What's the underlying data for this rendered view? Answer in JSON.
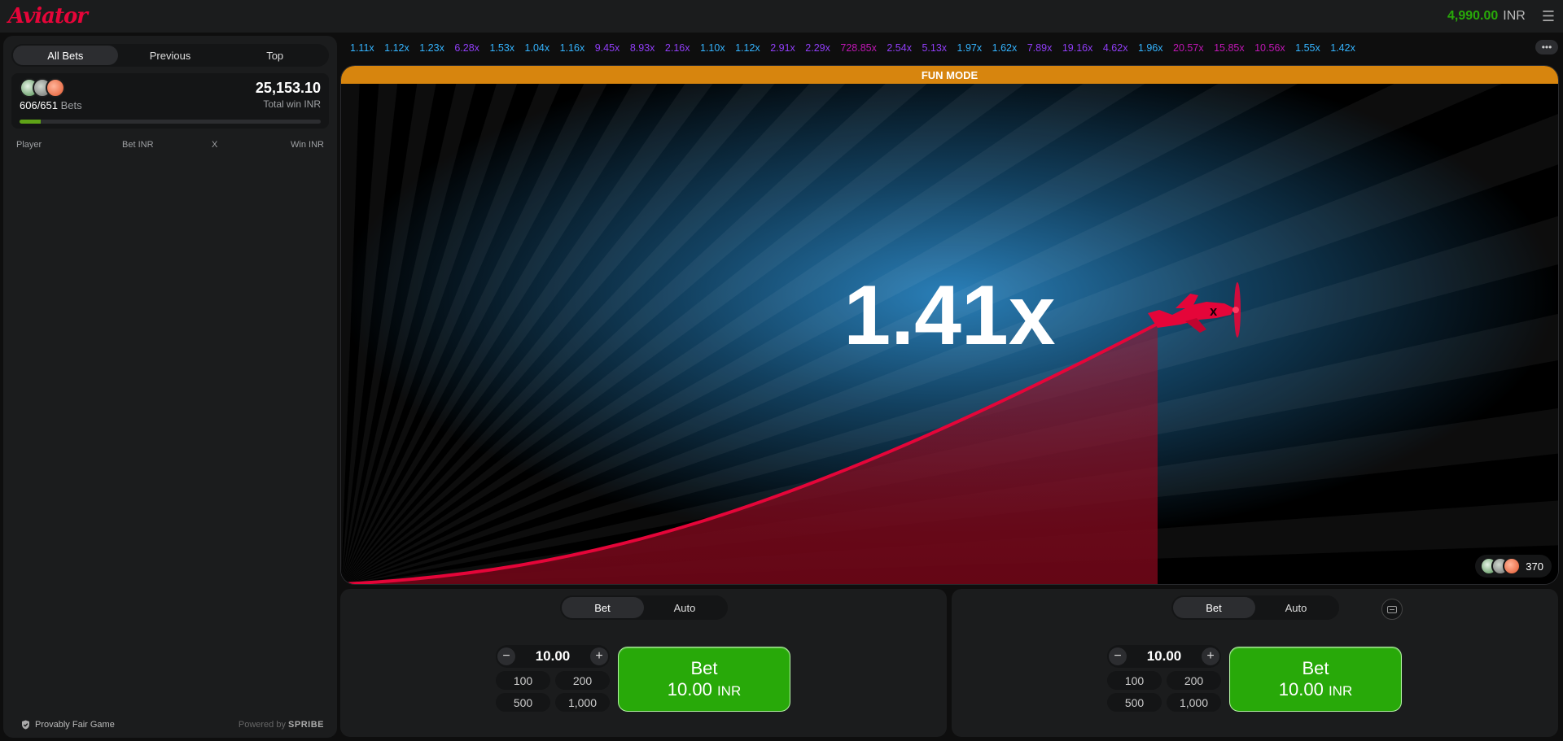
{
  "app": {
    "logo": "Aviator",
    "balance": "4,990.00",
    "currency": "INR"
  },
  "left": {
    "tabs": [
      "All Bets",
      "Previous",
      "Top"
    ],
    "active_tab": "All Bets",
    "bets_count": "606/651",
    "bets_label": "Bets",
    "total_win": "25,153.10",
    "total_win_label": "Total win INR",
    "bets_progress": 0.07,
    "columns": [
      "Player",
      "Bet INR",
      "X",
      "Win INR"
    ],
    "provably_fair": "Provably Fair Game",
    "powered_by": "Powered by",
    "provider": "SPRIBE"
  },
  "history": [
    {
      "v": "1.11x",
      "c": "blue"
    },
    {
      "v": "1.12x",
      "c": "blue"
    },
    {
      "v": "1.23x",
      "c": "blue"
    },
    {
      "v": "6.28x",
      "c": "purple"
    },
    {
      "v": "1.53x",
      "c": "blue"
    },
    {
      "v": "1.04x",
      "c": "blue"
    },
    {
      "v": "1.16x",
      "c": "blue"
    },
    {
      "v": "9.45x",
      "c": "purple"
    },
    {
      "v": "8.93x",
      "c": "purple"
    },
    {
      "v": "2.16x",
      "c": "purple"
    },
    {
      "v": "1.10x",
      "c": "blue"
    },
    {
      "v": "1.12x",
      "c": "blue"
    },
    {
      "v": "2.91x",
      "c": "purple"
    },
    {
      "v": "2.29x",
      "c": "purple"
    },
    {
      "v": "728.85x",
      "c": "pink"
    },
    {
      "v": "2.54x",
      "c": "purple"
    },
    {
      "v": "5.13x",
      "c": "purple"
    },
    {
      "v": "1.97x",
      "c": "blue"
    },
    {
      "v": "1.62x",
      "c": "blue"
    },
    {
      "v": "7.89x",
      "c": "purple"
    },
    {
      "v": "19.16x",
      "c": "purple"
    },
    {
      "v": "4.62x",
      "c": "purple"
    },
    {
      "v": "1.96x",
      "c": "blue"
    },
    {
      "v": "20.57x",
      "c": "pink"
    },
    {
      "v": "15.85x",
      "c": "pink"
    },
    {
      "v": "10.56x",
      "c": "pink"
    },
    {
      "v": "1.55x",
      "c": "blue"
    },
    {
      "v": "1.42x",
      "c": "blue"
    }
  ],
  "history_colors": {
    "blue": "#34b4ff",
    "purple": "#913ef8",
    "pink": "#c017b4"
  },
  "game": {
    "mode_banner": "FUN MODE",
    "multiplier": "1.41x",
    "players_online": "370"
  },
  "bet_panels": [
    {
      "tabs": [
        "Bet",
        "Auto"
      ],
      "active_tab": "Bet",
      "stake": "10.00",
      "quick": [
        "100",
        "200",
        "500",
        "1,000"
      ],
      "button_title": "Bet",
      "button_amount": "10.00",
      "button_currency": "INR"
    },
    {
      "tabs": [
        "Bet",
        "Auto"
      ],
      "active_tab": "Bet",
      "stake": "10.00",
      "quick": [
        "100",
        "200",
        "500",
        "1,000"
      ],
      "button_title": "Bet",
      "button_amount": "10.00",
      "button_currency": "INR"
    }
  ],
  "colors": {
    "accent_red": "#e50539",
    "bet_green": "#28a909",
    "fun_orange": "#d7850e"
  }
}
